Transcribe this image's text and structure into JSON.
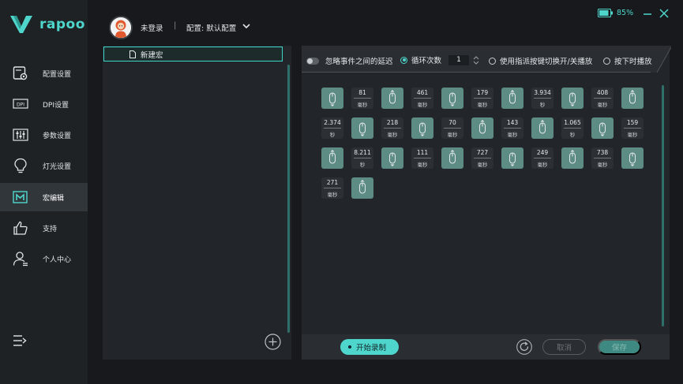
{
  "brand": {
    "logo_text": "rapoo"
  },
  "colors": {
    "accent": "#4fd6cc",
    "tile_mouse": "#5d8c84",
    "tile_delay": "#2c3034",
    "sidebar_bg": "#1f2225",
    "active_bg": "#31363a"
  },
  "sidebar": {
    "items": [
      {
        "label": "配置设置",
        "icon": "profile-settings-icon",
        "active": false
      },
      {
        "label": "DPI设置",
        "icon": "dpi-icon",
        "active": false
      },
      {
        "label": "参数设置",
        "icon": "sliders-icon",
        "active": false
      },
      {
        "label": "灯光设置",
        "icon": "lightbulb-icon",
        "active": false
      },
      {
        "label": "宏编辑",
        "icon": "macro-icon",
        "active": true
      },
      {
        "label": "支持",
        "icon": "thumbs-up-icon",
        "active": false
      },
      {
        "label": "个人中心",
        "icon": "user-icon",
        "active": false
      }
    ]
  },
  "header": {
    "login_status": "未登录",
    "separator": "|",
    "profile": "配置: 默认配置",
    "battery": "85%"
  },
  "macro_list": {
    "items": [
      {
        "label": "新建宏",
        "selected": true
      }
    ]
  },
  "options": {
    "ignore_delay": "忽略事件之间的延迟",
    "loop_count_label": "循环次数",
    "loop_count": "1",
    "toggle_mode": "使用指派按键切换开/关播放",
    "hold_mode": "按下时播放",
    "selected_mode": "loop"
  },
  "events": [
    {
      "kind": "mouse",
      "dir": "down"
    },
    {
      "kind": "delay",
      "value": "81",
      "unit": "毫秒"
    },
    {
      "kind": "mouse",
      "dir": "up"
    },
    {
      "kind": "delay",
      "value": "461",
      "unit": "毫秒"
    },
    {
      "kind": "mouse",
      "dir": "down"
    },
    {
      "kind": "delay",
      "value": "179",
      "unit": "毫秒"
    },
    {
      "kind": "mouse",
      "dir": "up"
    },
    {
      "kind": "delay",
      "value": "3.934",
      "unit": "秒"
    },
    {
      "kind": "mouse",
      "dir": "down"
    },
    {
      "kind": "delay",
      "value": "408",
      "unit": "毫秒"
    },
    {
      "kind": "mouse",
      "dir": "up"
    },
    {
      "kind": "delay",
      "value": "2.374",
      "unit": "秒"
    },
    {
      "kind": "mouse",
      "dir": "down"
    },
    {
      "kind": "delay",
      "value": "218",
      "unit": "毫秒"
    },
    {
      "kind": "mouse",
      "dir": "down"
    },
    {
      "kind": "delay",
      "value": "70",
      "unit": "毫秒"
    },
    {
      "kind": "mouse",
      "dir": "up"
    },
    {
      "kind": "delay",
      "value": "143",
      "unit": "毫秒"
    },
    {
      "kind": "mouse",
      "dir": "up"
    },
    {
      "kind": "delay",
      "value": "1.065",
      "unit": "秒"
    },
    {
      "kind": "mouse",
      "dir": "down"
    },
    {
      "kind": "delay",
      "value": "159",
      "unit": "毫秒"
    },
    {
      "kind": "mouse",
      "dir": "up"
    },
    {
      "kind": "delay",
      "value": "8.211",
      "unit": "秒"
    },
    {
      "kind": "mouse",
      "dir": "down"
    },
    {
      "kind": "delay",
      "value": "111",
      "unit": "毫秒"
    },
    {
      "kind": "mouse",
      "dir": "up"
    },
    {
      "kind": "delay",
      "value": "727",
      "unit": "毫秒"
    },
    {
      "kind": "mouse",
      "dir": "down"
    },
    {
      "kind": "delay",
      "value": "249",
      "unit": "毫秒"
    },
    {
      "kind": "mouse",
      "dir": "up"
    },
    {
      "kind": "delay",
      "value": "738",
      "unit": "毫秒"
    },
    {
      "kind": "mouse",
      "dir": "down"
    },
    {
      "kind": "delay",
      "value": "271",
      "unit": "毫秒"
    },
    {
      "kind": "mouse",
      "dir": "up"
    }
  ],
  "footer": {
    "record": "开始录制",
    "cancel": "取消",
    "save": "保存"
  }
}
